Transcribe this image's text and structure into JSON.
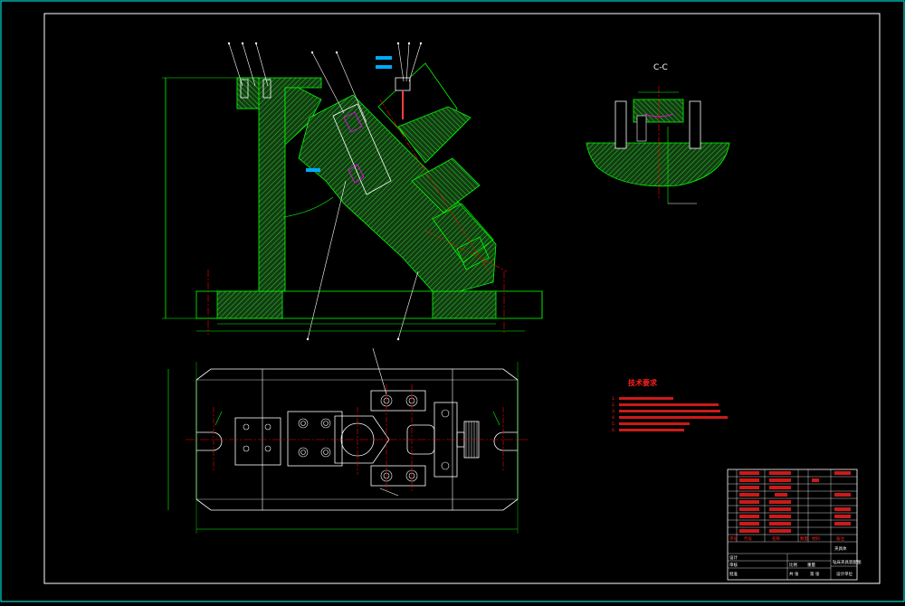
{
  "drawing": {
    "section_label": "C-C",
    "tech_requirements": {
      "heading": "技术要求",
      "items": [
        "1.",
        "2.",
        "3.",
        "4.",
        "5.",
        "6."
      ]
    },
    "title_block": {
      "header_cells": [
        "序号",
        "代号",
        "名称",
        "数量",
        "材料",
        "备注"
      ],
      "part_name": "夹具体",
      "drawing_name": "钻床夹具装配图",
      "company": "设计单位",
      "labels": [
        "设计",
        "审核",
        "批准",
        "比例",
        "重量",
        "共 张",
        "第 张"
      ]
    },
    "colors": {
      "background": "#000000",
      "frame": "#00ffff",
      "inner_frame": "#ffffff",
      "hatch": "#00ff00",
      "part_fill": "#1a4d1a",
      "centerline": "#ff0000",
      "dimension": "#00ff00",
      "leader": "#ffffff",
      "highlight": "#ff00ff",
      "note_text": "#ff2020"
    }
  }
}
